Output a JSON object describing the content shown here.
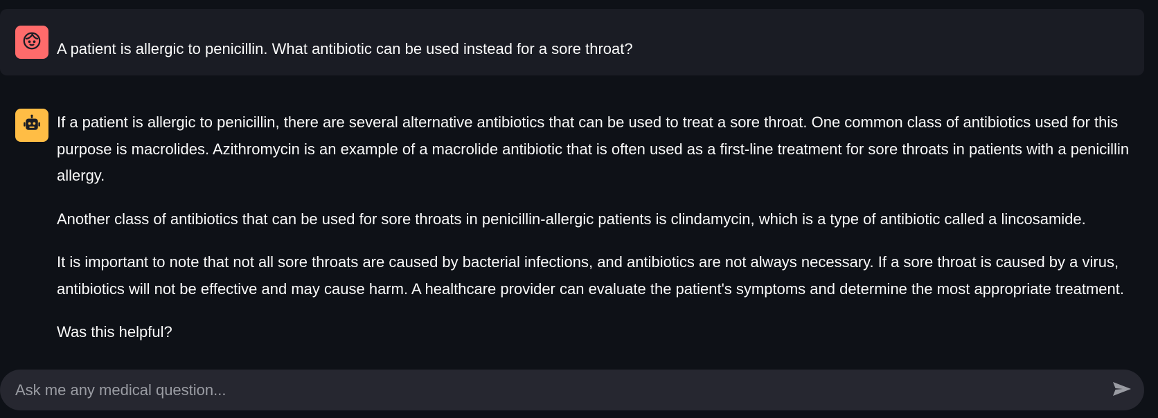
{
  "conversation": {
    "user_message": "A patient is allergic to penicillin. What antibiotic can be used instead for a sore throat?",
    "assistant_paragraphs": [
      "If a patient is allergic to penicillin, there are several alternative antibiotics that can be used to treat a sore throat. One common class of antibiotics used for this purpose is macrolides. Azithromycin is an example of a macrolide antibiotic that is often used as a first-line treatment for sore throats in patients with a penicillin allergy.",
      "Another class of antibiotics that can be used for sore throats in penicillin-allergic patients is clindamycin, which is a type of antibiotic called a lincosamide.",
      "It is important to note that not all sore throats are caused by bacterial infections, and antibiotics are not always necessary. If a sore throat is caused by a virus, antibiotics will not be effective and may cause harm. A healthcare provider can evaluate the patient's symptoms and determine the most appropriate treatment.",
      "Was this helpful?"
    ],
    "user_avatar_icon": "user-face-icon",
    "assistant_avatar_icon": "robot-icon"
  },
  "chat_input": {
    "placeholder": "Ask me any medical question...",
    "value": "",
    "send_icon": "send-icon"
  },
  "colors": {
    "background": "#0e1117",
    "user_bubble": "#1a1c24",
    "user_avatar": "#ff6b6b",
    "assistant_avatar": "#ffbd45",
    "input_background": "#262730",
    "text": "#fafafa",
    "placeholder": "#9a9ca3"
  }
}
